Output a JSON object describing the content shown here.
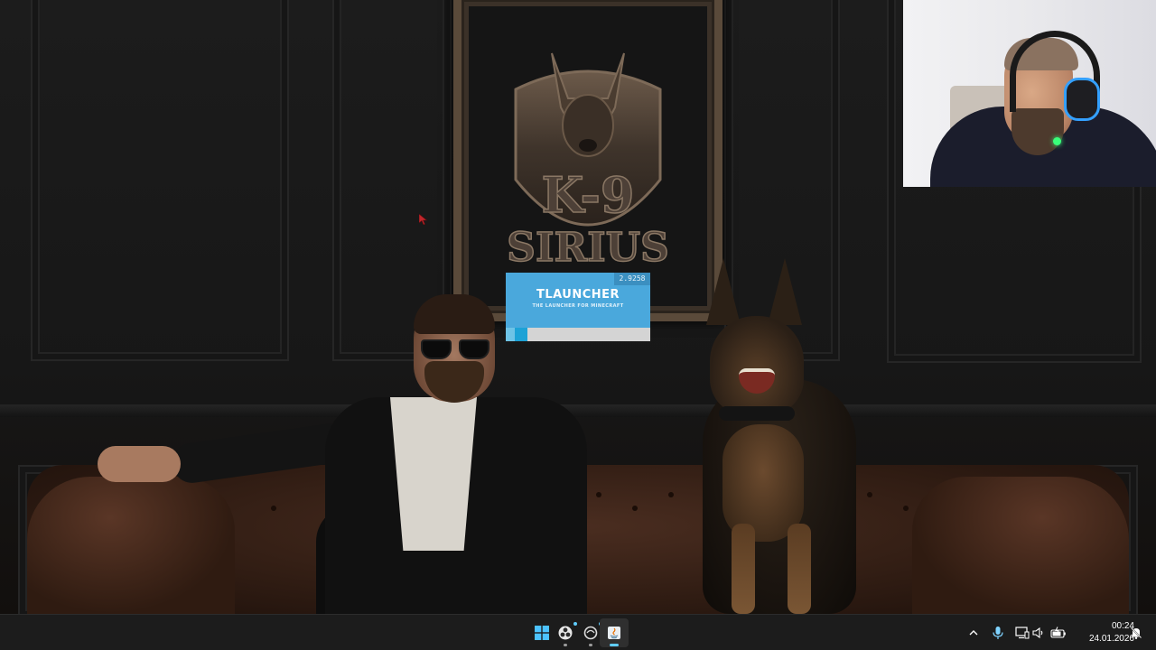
{
  "wallpaper": {
    "emblem_line1": "K-9",
    "emblem_line2": "SIRIUS",
    "colors": {
      "wall": "#1a1a1a",
      "frame": "#5a4a3a",
      "sofa": "#3a2218"
    }
  },
  "splash": {
    "app": "TLauncher",
    "version": "2.9258",
    "title": "TLAUNCHER",
    "subtitle": "THE LAUNCHER FOR MINECRAFT",
    "progress": 0.15,
    "colors": {
      "header": "#4aa8dc",
      "bar_fill": "#1da2d6",
      "track": "#d4d4d4"
    }
  },
  "webcam": {
    "description_icon": "webcam-feed"
  },
  "cursor": {
    "icon": "arrow-cursor-icon",
    "color": "#c0262b"
  },
  "taskbar": {
    "apps": [
      {
        "name": "start",
        "icon": "windows-start-icon",
        "active": false
      },
      {
        "name": "obs",
        "icon": "obs-icon",
        "active": false,
        "running": true
      },
      {
        "name": "app-circle",
        "icon": "circle-app-icon",
        "active": false,
        "running": true
      },
      {
        "name": "java",
        "icon": "java-icon",
        "active": true
      }
    ],
    "tray": {
      "overflow_icon": "chevron-up-icon",
      "mic_icon": "microphone-icon",
      "network_icon": "network-icon",
      "volume_icon": "speaker-icon",
      "battery_icon": "battery-icon",
      "notification_icon": "notification-bell-icon"
    },
    "clock": {
      "time": "00:24",
      "date": "24.01.2026"
    },
    "accent": "#60cdff"
  }
}
